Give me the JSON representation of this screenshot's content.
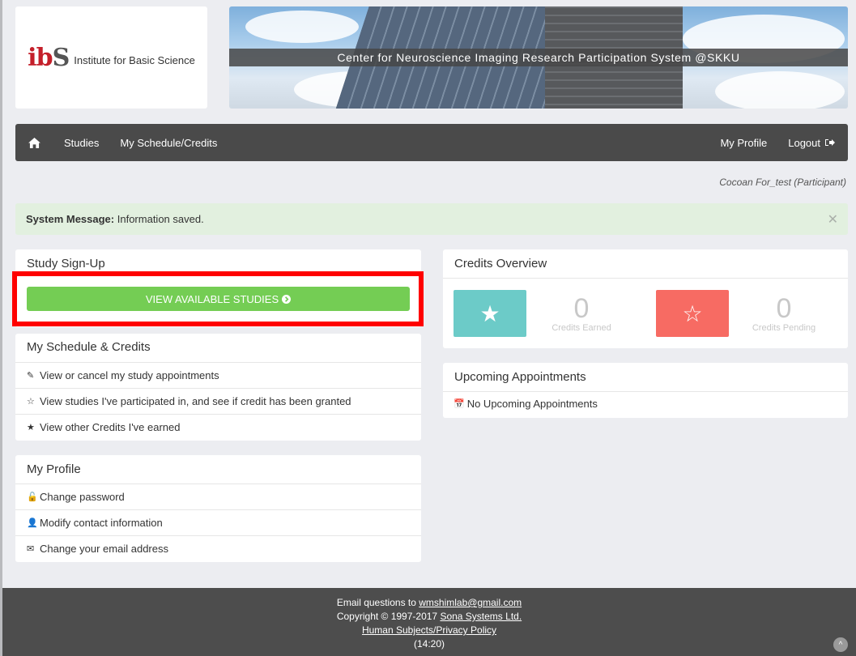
{
  "header": {
    "logo_mark_i": "i",
    "logo_mark_b": "b",
    "logo_mark_s": "S",
    "logo_text": "Institute for Basic Science",
    "banner_title": "Center for Neuroscience Imaging Research Participation System @SKKU"
  },
  "nav": {
    "home_icon": "home-icon",
    "studies": "Studies",
    "schedule": "My Schedule/Credits",
    "profile": "My Profile",
    "logout": "Logout"
  },
  "user": {
    "line": "Cocoan For_test (Participant)"
  },
  "system_message": {
    "label": "System Message:",
    "text": "Information saved."
  },
  "signup": {
    "title": "Study Sign-Up",
    "button": "VIEW AVAILABLE STUDIES"
  },
  "schedule_panel": {
    "title": "My Schedule & Credits",
    "items": [
      {
        "icon": "edit-icon",
        "label": "View or cancel my study appointments"
      },
      {
        "icon": "half-star-icon",
        "label": "View studies I've participated in, and see if credit has been granted"
      },
      {
        "icon": "star-icon",
        "label": "View other Credits I've earned"
      }
    ]
  },
  "profile_panel": {
    "title": "My Profile",
    "items": [
      {
        "icon": "lock-icon",
        "label": "Change password"
      },
      {
        "icon": "user-icon",
        "label": "Modify contact information"
      },
      {
        "icon": "envelope-icon",
        "label": "Change your email address"
      }
    ]
  },
  "credits": {
    "title": "Credits Overview",
    "earned_value": "0",
    "earned_label": "Credits Earned",
    "pending_value": "0",
    "pending_label": "Credits Pending",
    "earned_color": "#6ccbc8",
    "pending_color": "#f76b63"
  },
  "appointments": {
    "title": "Upcoming Appointments",
    "empty": "No Upcoming Appointments"
  },
  "footer": {
    "email_prefix": "Email questions to ",
    "email": "wmshimlab@gmail.com",
    "copyright_prefix": "Copyright © 1997-2017 ",
    "sona": "Sona Systems Ltd.",
    "policy": "Human Subjects/Privacy Policy",
    "time": "(14:20)"
  }
}
